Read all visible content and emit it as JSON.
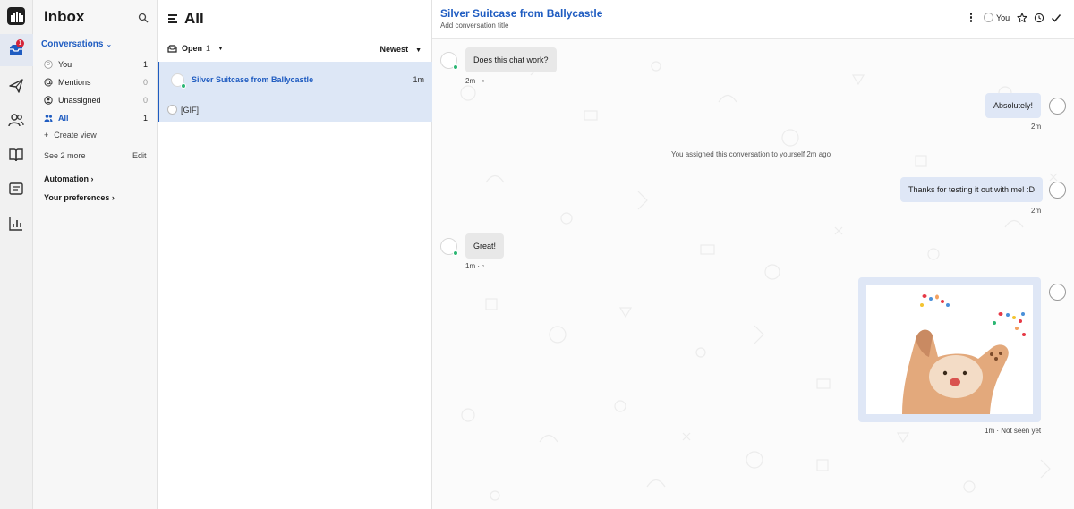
{
  "rail": {
    "inbox_badge": "1"
  },
  "nav": {
    "title": "Inbox",
    "section": "Conversations",
    "items": [
      {
        "label": "You",
        "count": "1"
      },
      {
        "label": "Mentions",
        "count": "0"
      },
      {
        "label": "Unassigned",
        "count": "0"
      },
      {
        "label": "All",
        "count": "1"
      }
    ],
    "create_view": "Create view",
    "see_more": "See 2 more",
    "edit": "Edit",
    "automation": "Automation",
    "preferences": "Your preferences"
  },
  "list": {
    "title": "All",
    "filter_label": "Open",
    "filter_count": "1",
    "sort_label": "Newest",
    "conversations": [
      {
        "name": "Silver Suitcase from Ballycastle",
        "time": "1m",
        "preview": "[GIF]"
      }
    ]
  },
  "chat": {
    "title": "Silver Suitcase from Ballycastle",
    "subtitle": "Add conversation title",
    "assignee": "You",
    "messages": [
      {
        "text": "Does this chat work?",
        "meta": "2m ·"
      },
      {
        "text": "Absolutely!",
        "meta": "2m"
      },
      {
        "text": "You assigned this conversation to yourself 2m ago"
      },
      {
        "text": "Thanks for testing it out with me! :D",
        "meta": "2m"
      },
      {
        "text": "Great!",
        "meta": "1m ·"
      },
      {
        "meta": "1m · Not seen yet"
      }
    ]
  },
  "colors": {
    "accent": "#1f5cc1",
    "selected_row": "#dde7f6",
    "incoming_bubble": "#e8e8e8",
    "outgoing_bubble": "#dfe7f6",
    "online": "#2bb673",
    "badge": "#d4253a"
  },
  "icons": [
    "logo-icon",
    "inbox-icon",
    "outbound-icon",
    "contacts-icon",
    "knowledge-icon",
    "reports-icon",
    "chart-icon",
    "search-icon",
    "mention-icon",
    "unassigned-icon",
    "team-icon",
    "menu-icon",
    "inbox-tray-icon",
    "more-icon",
    "star-icon",
    "snooze-icon",
    "check-icon"
  ]
}
